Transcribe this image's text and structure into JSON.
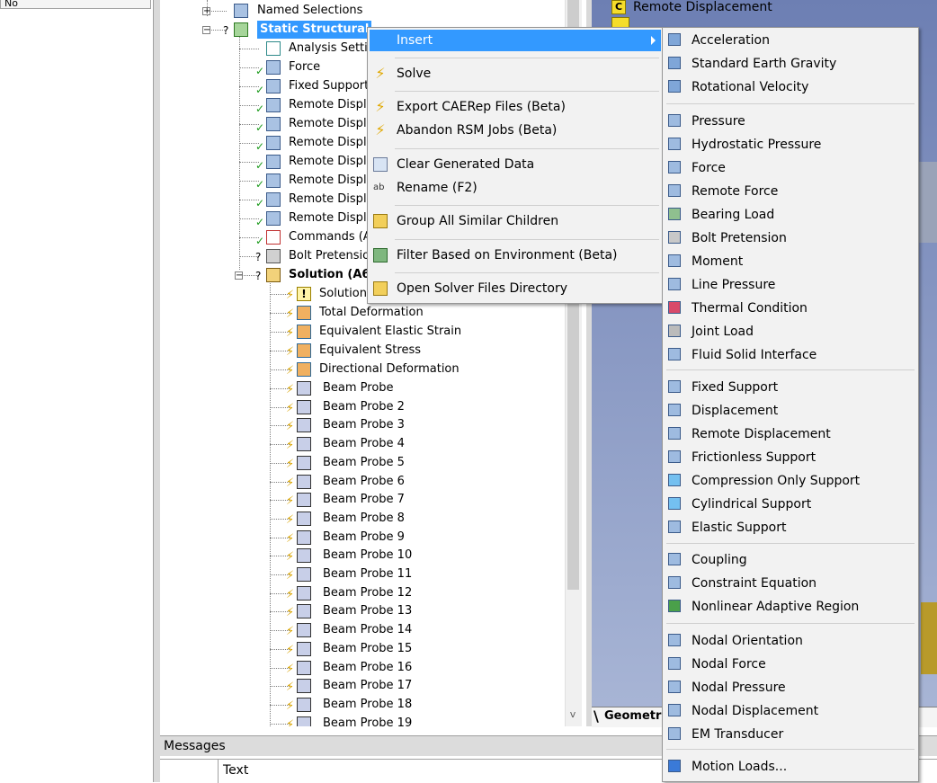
{
  "left_stub": {
    "header": "No"
  },
  "tree": {
    "nodes": [
      {
        "label": "Named Selections"
      },
      {
        "label": "Static Structural"
      },
      {
        "label": "Analysis Settin"
      },
      {
        "label": "Force"
      },
      {
        "label": "Fixed Support"
      },
      {
        "label": "Remote Displa"
      },
      {
        "label": "Remote Displa"
      },
      {
        "label": "Remote Displa"
      },
      {
        "label": "Remote Displa"
      },
      {
        "label": "Remote Displa"
      },
      {
        "label": "Remote Displa"
      },
      {
        "label": "Remote Displa"
      },
      {
        "label": "Commands (A"
      },
      {
        "label": "Bolt Pretensio"
      },
      {
        "label": "Solution (A6"
      },
      {
        "label": "Solution"
      },
      {
        "label": "Total Deformation"
      },
      {
        "label": "Equivalent Elastic Strain"
      },
      {
        "label": "Equivalent Stress"
      },
      {
        "label": "Directional Deformation"
      },
      {
        "label": "Beam Probe"
      },
      {
        "label": "Beam Probe 2"
      },
      {
        "label": "Beam Probe 3"
      },
      {
        "label": "Beam Probe 4"
      },
      {
        "label": "Beam Probe 5"
      },
      {
        "label": "Beam Probe 6"
      },
      {
        "label": "Beam Probe 7"
      },
      {
        "label": "Beam Probe 8"
      },
      {
        "label": "Beam Probe 9"
      },
      {
        "label": "Beam Probe 10"
      },
      {
        "label": "Beam Probe 11"
      },
      {
        "label": "Beam Probe 12"
      },
      {
        "label": "Beam Probe 13"
      },
      {
        "label": "Beam Probe 14"
      },
      {
        "label": "Beam Probe 15"
      },
      {
        "label": "Beam Probe 16"
      },
      {
        "label": "Beam Probe 17"
      },
      {
        "label": "Beam Probe 18"
      },
      {
        "label": "Beam Probe 19"
      }
    ],
    "scroll_down_glyph": "v"
  },
  "geometry": {
    "legend_badge": "C",
    "legend_label": "Remote Displacement",
    "tab_label": "Geometr",
    "background_top": "#6d7fb3",
    "part_color": "#b89a2a"
  },
  "context_menu": {
    "items": [
      {
        "label": "Insert",
        "icon": "none",
        "highlighted": true,
        "has_submenu": true
      },
      {
        "label": "Solve",
        "icon": "lightning-icon"
      },
      {
        "label": "Export CAERep Files (Beta)",
        "icon": "lightning-icon"
      },
      {
        "label": "Abandon RSM Jobs (Beta)",
        "icon": "lightning-icon"
      },
      {
        "label": "Clear Generated Data",
        "icon": "eraser-icon"
      },
      {
        "label": "Rename (F2)",
        "icon": "rename-icon"
      },
      {
        "label": "Group All Similar Children",
        "icon": "folder-icon"
      },
      {
        "label": "Filter Based on Environment (Beta)",
        "icon": "filter-icon"
      },
      {
        "label": "Open Solver Files Directory",
        "icon": "open-folder-icon"
      }
    ]
  },
  "insert_submenu": {
    "items": [
      {
        "label": "Acceleration"
      },
      {
        "label": "Standard Earth Gravity"
      },
      {
        "label": "Rotational Velocity"
      },
      {
        "label": "Pressure"
      },
      {
        "label": "Hydrostatic Pressure"
      },
      {
        "label": "Force"
      },
      {
        "label": "Remote Force"
      },
      {
        "label": "Bearing Load"
      },
      {
        "label": "Bolt Pretension"
      },
      {
        "label": "Moment"
      },
      {
        "label": "Line Pressure"
      },
      {
        "label": "Thermal Condition"
      },
      {
        "label": "Joint Load"
      },
      {
        "label": "Fluid Solid Interface"
      },
      {
        "label": "Fixed Support"
      },
      {
        "label": "Displacement"
      },
      {
        "label": "Remote Displacement"
      },
      {
        "label": "Frictionless Support"
      },
      {
        "label": "Compression Only Support"
      },
      {
        "label": "Cylindrical Support"
      },
      {
        "label": "Elastic Support"
      },
      {
        "label": "Coupling"
      },
      {
        "label": "Constraint Equation"
      },
      {
        "label": "Nonlinear Adaptive Region"
      },
      {
        "label": "Nodal Orientation"
      },
      {
        "label": "Nodal Force"
      },
      {
        "label": "Nodal Pressure"
      },
      {
        "label": "Nodal Displacement"
      },
      {
        "label": "EM Transducer"
      },
      {
        "label": "Motion Loads..."
      }
    ]
  },
  "messages": {
    "title": "Messages",
    "column_text": "Text"
  },
  "colors": {
    "selection": "#3399ff",
    "menu_bg": "#f2f2f2",
    "bolt": "#e0a800",
    "check": "#1a9a1a"
  }
}
